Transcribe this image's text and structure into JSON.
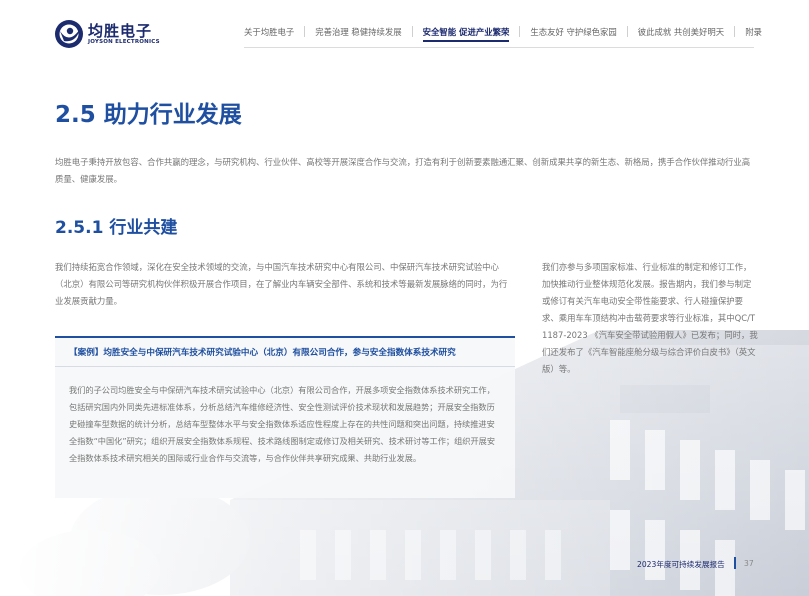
{
  "logo": {
    "name": "均胜电子",
    "sub": "JOYSON ELECTRONICS"
  },
  "nav": {
    "items": [
      {
        "label": "关于均胜电子",
        "active": false
      },
      {
        "label": "完善治理 稳健持续发展",
        "active": false
      },
      {
        "label": "安全智能 促进产业繁荣",
        "active": true
      },
      {
        "label": "生态友好 守护绿色家园",
        "active": false
      },
      {
        "label": "彼此成就 共创美好明天",
        "active": false
      },
      {
        "label": "附录",
        "active": false
      }
    ]
  },
  "section": {
    "title": "2.5 助力行业发展",
    "intro": "均胜电子秉持开放包容、合作共赢的理念，与研究机构、行业伙伴、高校等开展深度合作与交流，打造有利于创新要素融通汇聚、创新成果共享的新生态、新格局，携手合作伙伴推动行业高质量、健康发展。"
  },
  "subsection": {
    "title": "2.5.1 行业共建",
    "para_left": "我们持续拓宽合作领域，深化在安全技术领域的交流，与中国汽车技术研究中心有限公司、中保研汽车技术研究试验中心（北京）有限公司等研究机构伙伴积极开展合作项目，在了解业内车辆安全部件、系统和技术等最新发展脉络的同时，为行业发展贡献力量。",
    "para_right": "我们亦参与多项国家标准、行业标准的制定和修订工作，加快推动行业整体规范化发展。报告期内，我们参与制定或修订有关汽车电动安全带性能要求、行人碰撞保护要求、乘用车车顶结构冲击载荷要求等行业标准，其中QC/T 1187-2023 《汽车安全带试验用假人》已发布；同时，我们还发布了《汽车智能座舱分级与综合评价白皮书》（英文版）等。"
  },
  "case": {
    "title": "【案例】均胜安全与中保研汽车技术研究试验中心（北京）有限公司合作，参与安全指数体系技术研究",
    "body": "我们的子公司均胜安全与中保研汽车技术研究试验中心（北京）有限公司合作，开展多项安全指数体系技术研究工作，包括研究国内外同类先进标准体系，分析总结汽车维修经济性、安全性测试评价技术现状和发展趋势；开展安全指数历史碰撞车型数据的统计分析，总结车型整体水平与安全指数体系适应性程度上存在的共性问题和突出问题，持续推进安全指数“中国化”研究；组织开展安全指数体系规程、技术路线图制定或修订及相关研究、技术研讨等工作；组织开展安全指数体系技术研究相关的国际或行业合作与交流等，与合作伙伴共享研究成果、共助行业发展。"
  },
  "footer": {
    "report": "2023年度可持续发展报告",
    "page": "37"
  },
  "colors": {
    "brand": "#1c2a6e",
    "heading": "#1f4fa0",
    "body_text": "#777777"
  }
}
